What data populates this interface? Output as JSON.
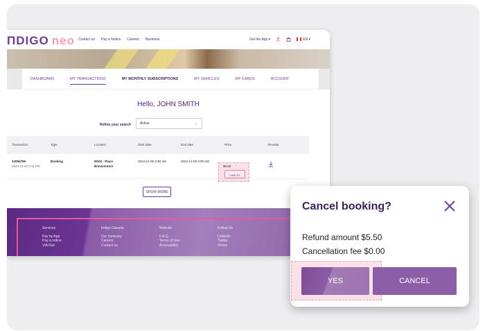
{
  "brand": {
    "name": "ΠDIGO",
    "suffix": "neo"
  },
  "topnav": {
    "links": [
      "Contact us",
      "Pay a Notice",
      "Careers",
      "Business"
    ],
    "get_app": "Get the App",
    "language": "EN"
  },
  "tabs": [
    "DASHBOARD",
    "MY TRANSACTIONS",
    "MY MONTHLY SUBSCRIPTIONS",
    "MY VEHICLES",
    "MY CARDS",
    "ACCOUNT"
  ],
  "greeting": "Hello, JOHN SMITH",
  "refine": {
    "label": "Refine your search",
    "value": "Active"
  },
  "table": {
    "headers": [
      "Transaction",
      "Type",
      "Location",
      "Start date",
      "End date",
      "Price",
      "Receipt"
    ],
    "row": {
      "id": "12094766",
      "datetime": "2024-12-02 3:11 PM",
      "type": "Booking",
      "location_line1": "M102 - Place",
      "location_line2": "Bonaventure",
      "start": "2024-12-09 2:30 AM",
      "end": "2024-12-09 3:00 AM",
      "price": "$5.50",
      "cancel_label": "CANCEL"
    }
  },
  "show_more": "SHOW MORE",
  "footer": {
    "columns": [
      {
        "heading": "Services",
        "items": [
          "Pay by App",
          "Pay a notice",
          "VIA Rail"
        ]
      },
      {
        "heading": "Indigo Canada",
        "items": [
          "Our company",
          "Careers",
          "Contact us"
        ]
      },
      {
        "heading": "Website",
        "items": [
          "F.A.Q.",
          "Terms of Use",
          "Accessibility"
        ]
      },
      {
        "heading": "Follow Us",
        "items": [
          "LinkedIn",
          "Twitter",
          "Vimeo"
        ]
      }
    ]
  },
  "modal": {
    "title": "Cancel booking?",
    "refund": "Refund amount $5.50",
    "fee": "Cancellation fee $0.00",
    "yes": "YES",
    "cancel": "CANCEL"
  },
  "colors": {
    "brand_purple": "#6b3d91",
    "accent_pink": "#e35aa2",
    "button_purple": "#8c5ea8"
  }
}
